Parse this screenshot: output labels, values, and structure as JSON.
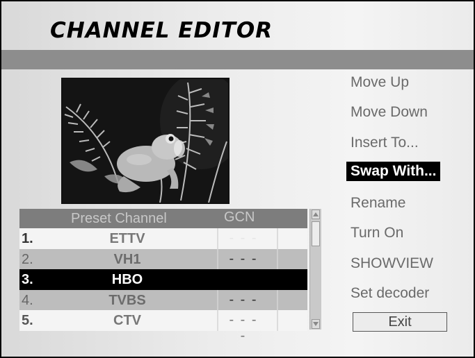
{
  "window": {
    "title": "CHANNEL EDITOR"
  },
  "preview": {
    "image": "frog-on-fern-photo"
  },
  "table": {
    "headers": {
      "channel": "Preset Channel",
      "gcn": "GCN"
    },
    "rows": [
      {
        "num": "1.",
        "name": "ETTV",
        "gcn": "- - - -",
        "state": "first"
      },
      {
        "num": "2.",
        "name": "VH1",
        "gcn": "- - - -",
        "state": "mid"
      },
      {
        "num": "3.",
        "name": "HBO",
        "gcn": "",
        "state": "selected"
      },
      {
        "num": "4.",
        "name": "TVBS",
        "gcn": "- - - -",
        "state": "mid"
      },
      {
        "num": "5.",
        "name": "CTV",
        "gcn": "- - - -",
        "state": "light"
      }
    ]
  },
  "menu": {
    "items": [
      {
        "label": "Move Up"
      },
      {
        "label": "Move Down"
      },
      {
        "label": "Insert To..."
      },
      {
        "label": "Swap With...",
        "selected": true
      },
      {
        "label": "Rename"
      },
      {
        "label": "Turn On"
      },
      {
        "label": "SHOWVIEW"
      },
      {
        "label": "Set decoder"
      }
    ],
    "exit_label": "Exit"
  },
  "icons": {
    "scroll_up": "triangle-up-icon",
    "scroll_down": "triangle-down-icon"
  }
}
